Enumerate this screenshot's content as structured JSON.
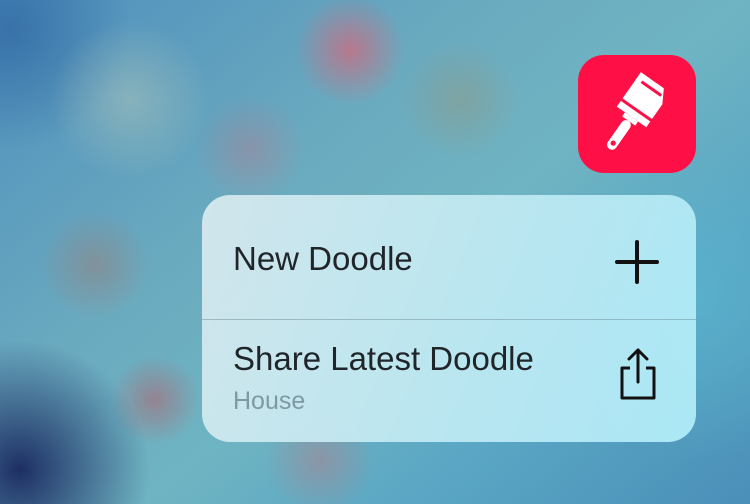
{
  "app": {
    "icon": "paint-brush-icon",
    "icon_color": "#fe0f45"
  },
  "quick_actions": [
    {
      "title": "New Doodle",
      "icon": "plus-icon"
    },
    {
      "title": "Share Latest Doodle",
      "subtitle": "House",
      "icon": "share-icon"
    }
  ]
}
